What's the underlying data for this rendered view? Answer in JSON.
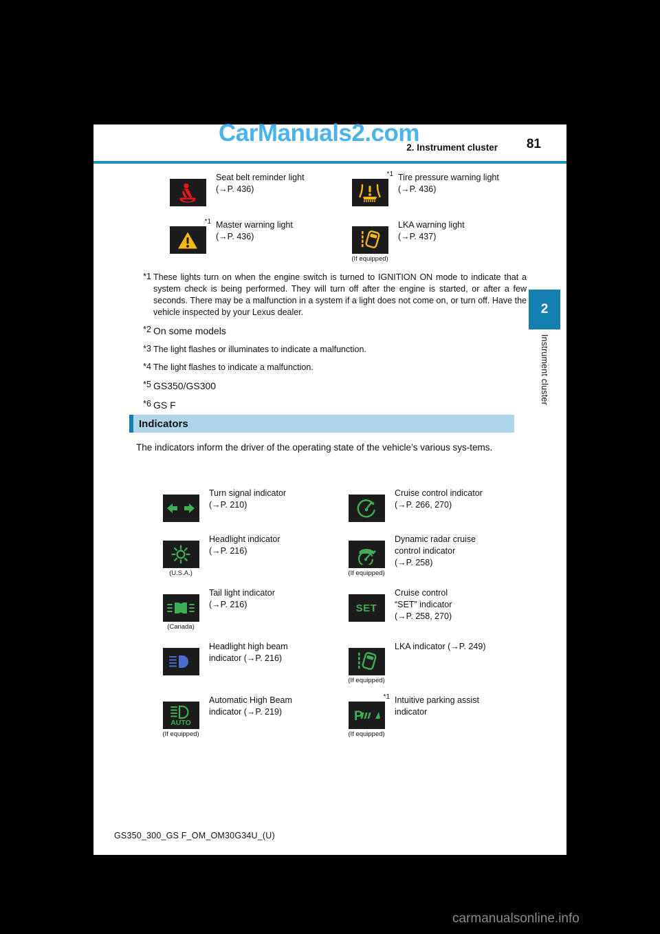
{
  "document": {
    "watermark_top": "CarManuals2.com",
    "watermark_bottom": "carmanualsonline.info",
    "header_title": "2. Instrument cluster",
    "page_number": "81",
    "footer_code": "GS350_300_GS F_OM_OM30G34U_(U)",
    "side_tab": {
      "chapter": "2",
      "label": "Instrument cluster"
    },
    "colors": {
      "accent": "#1580b0",
      "section_bg": "#aed6e8",
      "watermark": "#4ab3ea"
    }
  },
  "warning_lights": [
    {
      "icon": "seat-belt-reminder-icon",
      "sup": "",
      "note": "",
      "lines": [
        "Seat belt reminder light",
        "(→P. 436)"
      ]
    },
    {
      "icon": "tire-pressure-warning-icon",
      "sup": "*1",
      "note": "",
      "lines": [
        "Tire pressure warning light",
        "(→P. 436)"
      ]
    },
    {
      "icon": "master-warning-icon",
      "sup": "*1",
      "note": "",
      "lines": [
        "Master warning light",
        "(→P. 436)"
      ]
    },
    {
      "icon": "lka-warning-icon",
      "sup": "",
      "note": "(If equipped)",
      "lines": [
        "LKA warning light",
        "(→P. 437)"
      ]
    }
  ],
  "footnotes": [
    {
      "mark": "*1",
      "text": "These lights turn on when the engine switch is turned to IGNITION ON mode to indicate that a system check is being performed. They will turn off after the engine is started, or after a few seconds. There may be a malfunction in a system if a light does not come on, or turn off. Have the vehicle inspected by your Lexus dealer."
    },
    {
      "mark": "*2",
      "text": "On some models"
    },
    {
      "mark": "*3",
      "text": "The light flashes or illuminates to indicate a malfunction."
    },
    {
      "mark": "*4",
      "text": "The light flashes to indicate a malfunction."
    },
    {
      "mark": "*5",
      "text": "GS350/GS300"
    },
    {
      "mark": "*6",
      "text": "GS F"
    }
  ],
  "indicators_section": {
    "title": "Indicators",
    "intro": "The indicators inform the driver of the operating state of the vehicle’s various sys-tems."
  },
  "indicators": [
    {
      "icon": "turn-signal-icon",
      "sup": "",
      "note": "",
      "lines": [
        "Turn signal indicator",
        "(→P. 210)"
      ]
    },
    {
      "icon": "cruise-control-icon",
      "sup": "",
      "note": "",
      "lines": [
        "Cruise control indicator",
        "(→P. 266, 270)"
      ]
    },
    {
      "icon": "headlight-icon",
      "sup": "",
      "note": "(U.S.A.)",
      "lines": [
        "Headlight indicator",
        "(→P. 216)"
      ]
    },
    {
      "icon": "dynamic-radar-cruise-icon",
      "sup": "",
      "note": "(If equipped)",
      "lines": [
        "Dynamic radar cruise",
        "control indicator",
        "(→P. 258)"
      ]
    },
    {
      "icon": "tail-light-icon",
      "sup": "",
      "note": "(Canada)",
      "lines": [
        "Tail light indicator",
        "(→P. 216)"
      ]
    },
    {
      "icon": "cruise-set-icon",
      "sup": "",
      "note": "",
      "lines": [
        "Cruise control",
        "“SET” indicator",
        "(→P. 258, 270)"
      ]
    },
    {
      "icon": "headlight-high-beam-icon",
      "sup": "",
      "note": "",
      "lines": [
        "Headlight high beam",
        "indicator (→P. 216)"
      ]
    },
    {
      "icon": "lka-indicator-icon",
      "sup": "",
      "note": "(If equipped)",
      "lines": [
        "LKA indicator (→P. 249)"
      ]
    },
    {
      "icon": "automatic-high-beam-icon",
      "sup": "",
      "note": "(If equipped)",
      "lines": [
        "Automatic High Beam",
        "indicator (→P. 219)"
      ]
    },
    {
      "icon": "intuitive-parking-assist-icon",
      "sup": "*1",
      "note": "(If equipped)",
      "lines": [
        "Intuitive parking assist",
        "indicator"
      ]
    }
  ]
}
